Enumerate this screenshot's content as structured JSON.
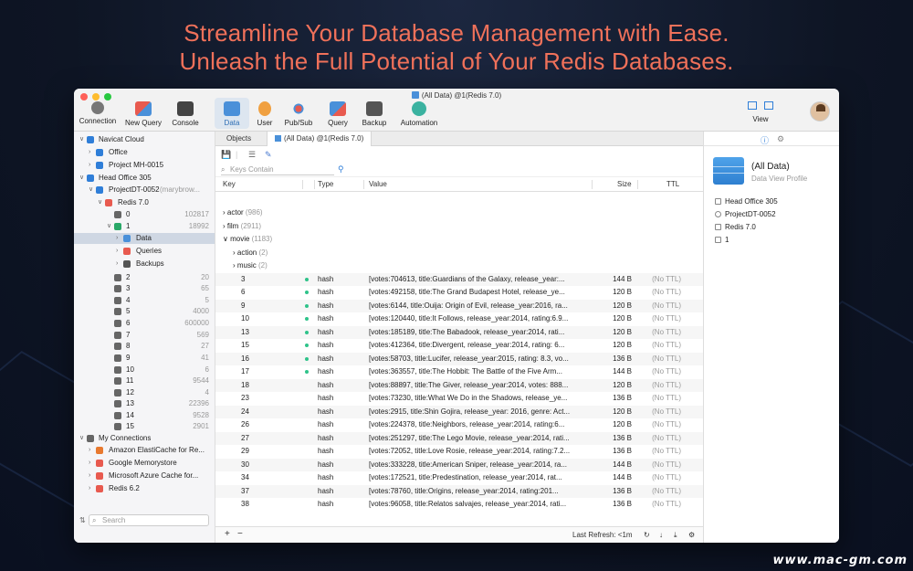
{
  "headline": {
    "line1": "Streamline Your Database Management with Ease.",
    "line2": "Unleash the Full Potential of Your Redis Databases."
  },
  "watermark": "www.mac-gm.com",
  "window": {
    "title": "(All Data) @1(Redis 7.0)",
    "toolbar": {
      "connection": "Connection",
      "new_query": "New Query",
      "console": "Console",
      "data": "Data",
      "user": "User",
      "pubsub": "Pub/Sub",
      "query": "Query",
      "backup": "Backup",
      "automation": "Automation",
      "view": "View"
    }
  },
  "sidebar": {
    "search_placeholder": "Search",
    "items": [
      {
        "label": "Navicat Cloud",
        "count": ""
      },
      {
        "label": "Office",
        "count": ""
      },
      {
        "label": "Project MH-0015",
        "count": ""
      },
      {
        "label": "Head Office 305",
        "count": ""
      },
      {
        "label": "ProjectDT-0052",
        "count": "(marybrow..."
      },
      {
        "label": "Redis 7.0",
        "count": ""
      },
      {
        "label": "0",
        "count": "102817"
      },
      {
        "label": "1",
        "count": "18992"
      },
      {
        "label": "Data",
        "count": ""
      },
      {
        "label": "Queries",
        "count": ""
      },
      {
        "label": "Backups",
        "count": ""
      },
      {
        "label": "2",
        "count": "20"
      },
      {
        "label": "3",
        "count": "65"
      },
      {
        "label": "4",
        "count": "5"
      },
      {
        "label": "5",
        "count": "4000"
      },
      {
        "label": "6",
        "count": "600000"
      },
      {
        "label": "7",
        "count": "569"
      },
      {
        "label": "8",
        "count": "27"
      },
      {
        "label": "9",
        "count": "41"
      },
      {
        "label": "10",
        "count": "6"
      },
      {
        "label": "11",
        "count": "9544"
      },
      {
        "label": "12",
        "count": "4"
      },
      {
        "label": "13",
        "count": "22396"
      },
      {
        "label": "14",
        "count": "9528"
      },
      {
        "label": "15",
        "count": "2901"
      },
      {
        "label": "My Connections",
        "count": ""
      },
      {
        "label": "Amazon ElastiCache for Re...",
        "count": ""
      },
      {
        "label": "Google Memorystore",
        "count": ""
      },
      {
        "label": "Microsoft Azure Cache for...",
        "count": ""
      },
      {
        "label": "Redis 6.2",
        "count": ""
      }
    ]
  },
  "tabs": {
    "objects": "Objects",
    "data_tab": "(All Data) @1(Redis 7.0)"
  },
  "search": {
    "keys_placeholder": "Keys Contain"
  },
  "table": {
    "headers": {
      "key": "Key",
      "type": "Type",
      "value": "Value",
      "size": "Size",
      "ttl": "TTL"
    },
    "groups": [
      {
        "name": "actor",
        "count": "(986)"
      },
      {
        "name": "film",
        "count": "(2911)"
      },
      {
        "name": "movie",
        "count": "(1183)"
      },
      {
        "name": "action",
        "count": "(2)"
      },
      {
        "name": "music",
        "count": "(2)"
      }
    ],
    "rows": [
      {
        "key": "3",
        "type": "hash",
        "value": "[votes:704613, title:Guardians of the Galaxy, release_year:...",
        "size": "144 B",
        "ttl": "(No TTL)",
        "dot": true
      },
      {
        "key": "6",
        "type": "hash",
        "value": "[votes:492158, title:The Grand Budapest Hotel, release_ye...",
        "size": "120 B",
        "ttl": "(No TTL)",
        "dot": true
      },
      {
        "key": "9",
        "type": "hash",
        "value": "[votes:6144, title:Ouija: Origin of Evil, release_year:2016, ra...",
        "size": "120 B",
        "ttl": "(No TTL)",
        "dot": true
      },
      {
        "key": "10",
        "type": "hash",
        "value": "[votes:120440, title:It Follows, release_year:2014, rating:6.9...",
        "size": "120 B",
        "ttl": "(No TTL)",
        "dot": true
      },
      {
        "key": "13",
        "type": "hash",
        "value": "[votes:185189, title:The Babadook, release_year:2014, rati...",
        "size": "120 B",
        "ttl": "(No TTL)",
        "dot": true
      },
      {
        "key": "15",
        "type": "hash",
        "value": "[votes:412364, title:Divergent, release_year:2014, rating: 6...",
        "size": "120 B",
        "ttl": "(No TTL)",
        "dot": true
      },
      {
        "key": "16",
        "type": "hash",
        "value": "[votes:58703, title:Lucifer, release_year:2015, rating: 8.3, vo...",
        "size": "136 B",
        "ttl": "(No TTL)",
        "dot": true
      },
      {
        "key": "17",
        "type": "hash",
        "value": "[votes:363557, title:The Hobbit: The Battle of the Five Arm...",
        "size": "144 B",
        "ttl": "(No TTL)",
        "dot": true
      },
      {
        "key": "18",
        "type": "hash",
        "value": "[votes:88897, title:The Giver, release_year:2014, votes: 888...",
        "size": "120 B",
        "ttl": "(No TTL)",
        "dot": false
      },
      {
        "key": "23",
        "type": "hash",
        "value": "[votes:73230, title:What We Do in the Shadows, release_ye...",
        "size": "136 B",
        "ttl": "(No TTL)",
        "dot": false
      },
      {
        "key": "24",
        "type": "hash",
        "value": "[votes:2915, title:Shin Gojira, release_year: 2016, genre: Act...",
        "size": "120 B",
        "ttl": "(No TTL)",
        "dot": false
      },
      {
        "key": "26",
        "type": "hash",
        "value": "[votes:224378, title:Neighbors, release_year:2014, rating:6...",
        "size": "120 B",
        "ttl": "(No TTL)",
        "dot": false
      },
      {
        "key": "27",
        "type": "hash",
        "value": "[votes:251297, title:The Lego Movie, release_year:2014, rati...",
        "size": "136 B",
        "ttl": "(No TTL)",
        "dot": false
      },
      {
        "key": "29",
        "type": "hash",
        "value": "[votes:72052, title:Love Rosie, release_year:2014, rating:7.2...",
        "size": "136 B",
        "ttl": "(No TTL)",
        "dot": false
      },
      {
        "key": "30",
        "type": "hash",
        "value": "[votes:333228, title:American Sniper, release_year:2014, ra...",
        "size": "144 B",
        "ttl": "(No TTL)",
        "dot": false
      },
      {
        "key": "34",
        "type": "hash",
        "value": "[votes:172521, title:Predestination, release_year:2014, rat...",
        "size": "144 B",
        "ttl": "(No TTL)",
        "dot": false
      },
      {
        "key": "37",
        "type": "hash",
        "value": "[votes:78760, title:Origins, release_year:2014, rating:201...",
        "size": "136 B",
        "ttl": "(No TTL)",
        "dot": false
      },
      {
        "key": "38",
        "type": "hash",
        "value": "[votes:96058, title:Relatos salvajes, release_year:2014, rati...",
        "size": "136 B",
        "ttl": "(No TTL)",
        "dot": false
      }
    ]
  },
  "status": {
    "last_refresh": "Last Refresh: <1m"
  },
  "panel": {
    "title": "(All Data)",
    "subtitle": "Data View Profile",
    "items": [
      "Head Office 305",
      "ProjectDT-0052",
      "Redis 7.0",
      "1"
    ]
  }
}
